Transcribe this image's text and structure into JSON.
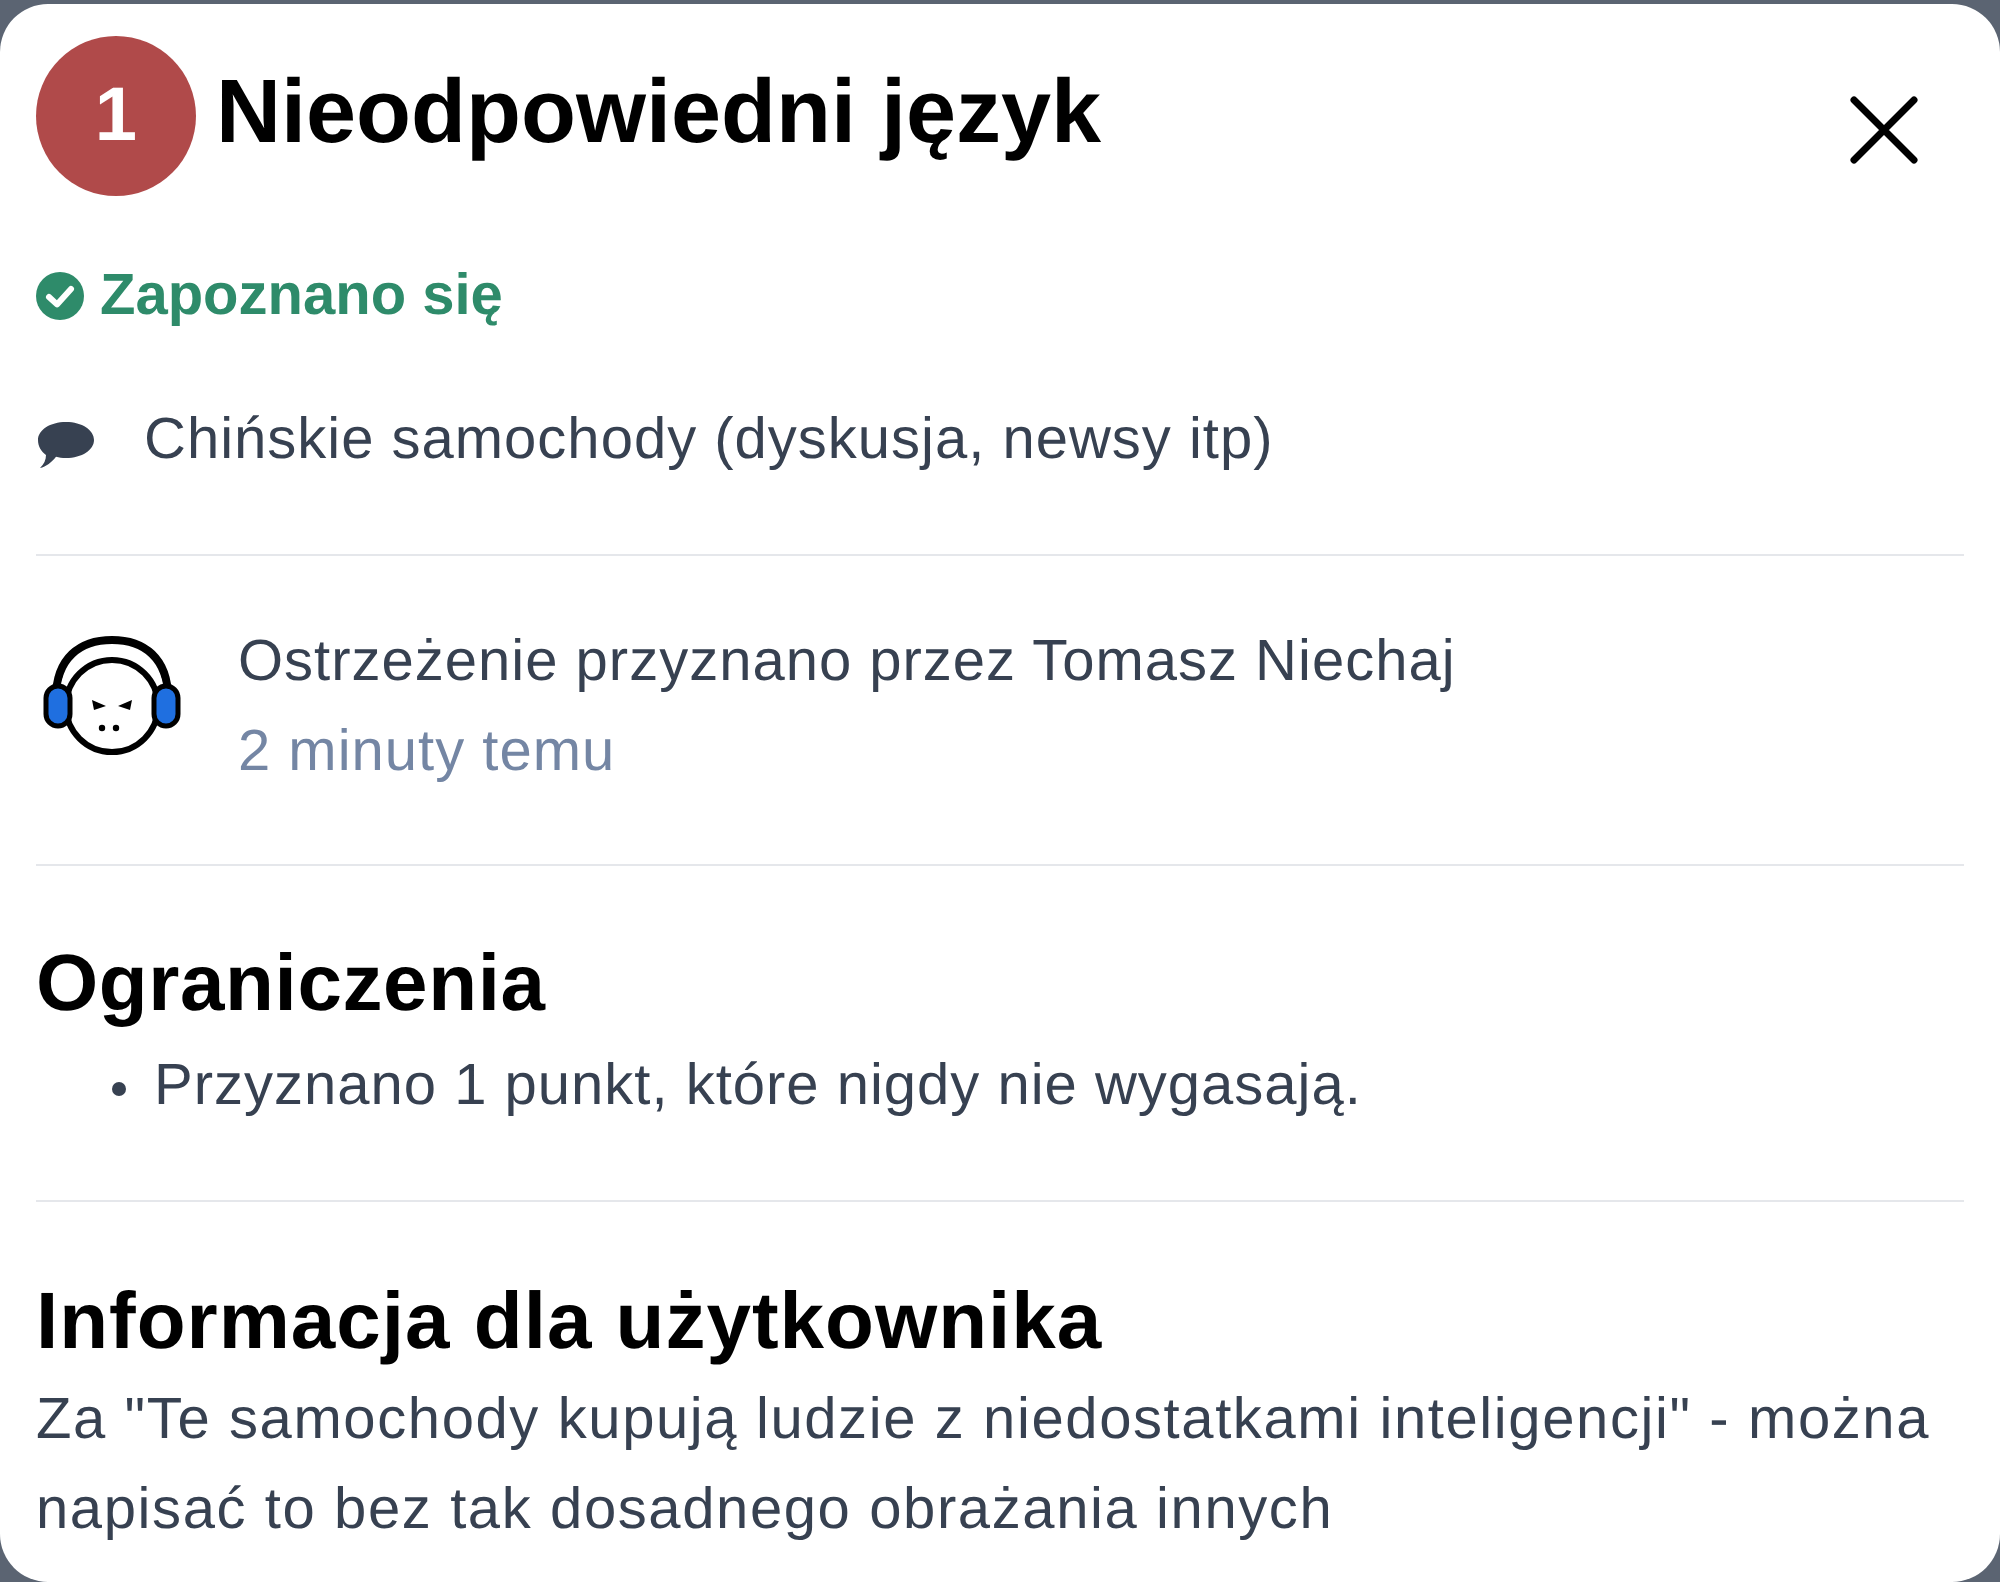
{
  "dialog": {
    "badge": "1",
    "title": "Nieodpowiedni język"
  },
  "status": {
    "label": "Zapoznano się"
  },
  "thread": {
    "title": "Chińskie samochody (dyskusja, newsy itp)"
  },
  "warning": {
    "given_by": "Ostrzeżenie przyznano przez Tomasz Niechaj",
    "time": "2 minuty temu"
  },
  "restrictions": {
    "heading": "Ograniczenia",
    "items": [
      "Przyznano 1 punkt, które nigdy nie wygasają."
    ]
  },
  "user_note": {
    "heading": "Informacja dla użytkownika",
    "text": "Za \"Te samochody kupują ludzie z niedostatkami inteligencji\" - można napisać to bez tak dosadnego obrażania innych"
  }
}
